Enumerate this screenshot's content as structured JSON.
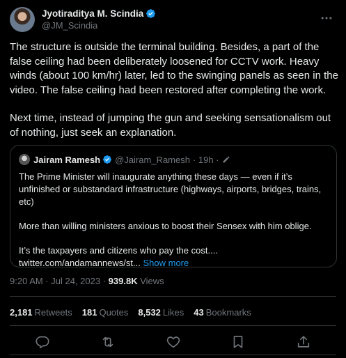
{
  "author": {
    "display_name": "Jyotiraditya M. Scindia",
    "handle": "@JM_Scindia",
    "verified_color": "#1d9bf0"
  },
  "tweet": {
    "paragraphs": [
      "The structure is outside the terminal building. Besides, a part of the false ceiling had been deliberately loosened for CCTV work. Heavy winds (about 100 km/hr) later, led to the swinging panels as seen in the video. The false ceiling had been restored after completing the work.",
      "Next time, instead of jumping the gun and seeking sensationalism out of nothing, just seek an explanation."
    ]
  },
  "quote": {
    "display_name": "Jairam Ramesh",
    "handle": "@Jairam_Ramesh",
    "time": "· 19h ·",
    "paragraphs": [
      "The Prime Minister will inaugurate anything these days — even if it’s unfinished or substandard infrastructure (highways, airports, bridges, trains, etc)",
      "More than willing ministers anxious to boost their Sensex with him oblige.",
      "It’s the taxpayers and citizens who pay the cost....",
      "twitter.com/andamannews/st..."
    ],
    "show_more": "Show more"
  },
  "meta": {
    "time": "9:20 AM · Jul 24, 2023 ·",
    "views_count": "939.8K",
    "views_label": "Views"
  },
  "stats": {
    "retweets_count": "2,181",
    "retweets_label": "Retweets",
    "quotes_count": "181",
    "quotes_label": "Quotes",
    "likes_count": "8,532",
    "likes_label": "Likes",
    "bookmarks_count": "43",
    "bookmarks_label": "Bookmarks"
  },
  "actions": [
    "reply-icon",
    "retweet-icon",
    "like-icon",
    "bookmark-icon",
    "share-icon"
  ],
  "colors": {
    "accent": "#1d9bf0",
    "muted": "#71767b",
    "text": "#e7e9ea",
    "border": "#2f3336",
    "background": "#000000"
  }
}
